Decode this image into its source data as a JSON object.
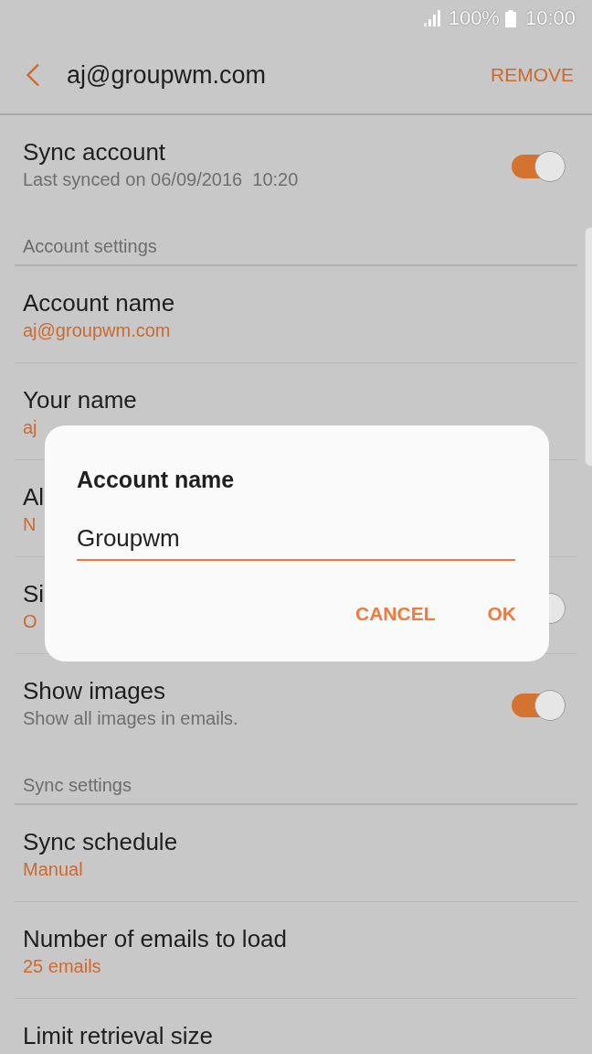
{
  "status_bar": {
    "battery_text": "100%",
    "time": "10:00"
  },
  "header": {
    "title": "aj@groupwm.com",
    "action": "REMOVE"
  },
  "sections": [
    {
      "items": [
        {
          "kind": "switch",
          "title": "Sync account",
          "subtitle": "Last synced on 06/09/2016  10:20",
          "on": true
        }
      ]
    },
    {
      "heading": "Account settings",
      "items": [
        {
          "kind": "option",
          "title": "Account name",
          "value": "aj@groupwm.com"
        },
        {
          "kind": "option",
          "title": "Your name",
          "value": "aj"
        },
        {
          "kind": "option",
          "title": "Al",
          "value": "N"
        },
        {
          "kind": "switch",
          "title": "Si",
          "value": "O",
          "on": true
        },
        {
          "kind": "switch",
          "title": "Show images",
          "subtitle": "Show all images in emails.",
          "on": true
        }
      ]
    },
    {
      "heading": "Sync settings",
      "items": [
        {
          "kind": "option",
          "title": "Sync schedule",
          "value": "Manual"
        },
        {
          "kind": "option",
          "title": "Number of emails to load",
          "value": "25 emails"
        },
        {
          "kind": "option",
          "title": "Limit retrieval size"
        }
      ]
    }
  ],
  "dialog": {
    "title": "Account name",
    "input_value": "Groupwm",
    "buttons": [
      "CANCEL",
      "OK"
    ]
  }
}
